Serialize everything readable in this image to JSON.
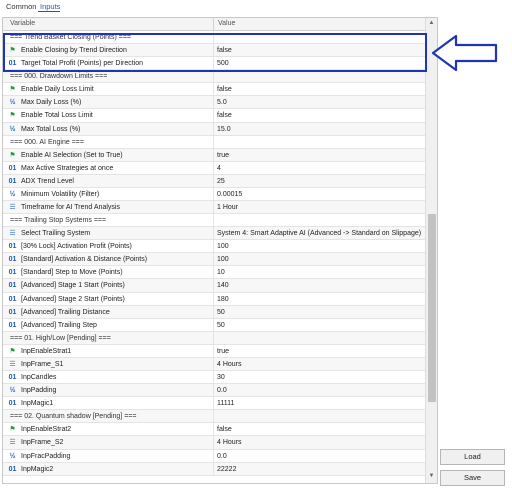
{
  "tabs": [
    {
      "label": "Common"
    },
    {
      "label": "Inputs"
    }
  ],
  "header": {
    "variable": "Variable",
    "value": "Value"
  },
  "rows": [
    {
      "type": "section",
      "label": "=== Trend Basket Closing (Points) ===",
      "value": ""
    },
    {
      "type": "bool",
      "icon": "flag-icon",
      "label": "Enable Closing by Trend Direction",
      "value": "false"
    },
    {
      "type": "int",
      "icon": "int-icon",
      "label": "Target Total Profit (Points) per Direction",
      "value": "500"
    },
    {
      "type": "section",
      "label": "=== 000. Drawdown Limits ===",
      "value": ""
    },
    {
      "type": "bool",
      "icon": "flag-icon",
      "label": "Enable Daily Loss Limit",
      "value": "false"
    },
    {
      "type": "frac",
      "icon": "fraction-icon",
      "label": "Max Daily Loss (%)",
      "value": "5.0"
    },
    {
      "type": "bool",
      "icon": "flag-icon",
      "label": "Enable Total Loss Limit",
      "value": "false"
    },
    {
      "type": "frac",
      "icon": "fraction-icon",
      "label": "Max Total Loss (%)",
      "value": "15.0"
    },
    {
      "type": "section",
      "label": "=== 000. AI Engine ===",
      "value": ""
    },
    {
      "type": "bool",
      "icon": "flag-icon",
      "label": "Enable AI Selection (Set to True)",
      "value": "true"
    },
    {
      "type": "int",
      "icon": "int-icon",
      "label": "Max Active Strategies at once",
      "value": "4"
    },
    {
      "type": "int",
      "icon": "int-icon",
      "label": "ADX Trend Level",
      "value": "25"
    },
    {
      "type": "frac",
      "icon": "fraction-icon",
      "label": "Minimum Volatility (Filter)",
      "value": "0.00015"
    },
    {
      "type": "list",
      "icon": "list-icon",
      "label": "Timeframe for AI Trend Analysis",
      "value": "1 Hour"
    },
    {
      "type": "section",
      "label": "=== Trailing Stop Systems ===",
      "value": ""
    },
    {
      "type": "list",
      "icon": "list-icon",
      "label": "Select Trailing System",
      "value": "System 4: Smart Adaptive AI (Advanced -> Standard on Slippage)"
    },
    {
      "type": "int",
      "icon": "int-icon",
      "label": "[30% Lock] Activation Profit (Points)",
      "value": "100"
    },
    {
      "type": "int",
      "icon": "int-icon",
      "label": "[Standard] Activation & Distance (Points)",
      "value": "100"
    },
    {
      "type": "int",
      "icon": "int-icon",
      "label": "[Standard] Step to Move (Points)",
      "value": "10"
    },
    {
      "type": "int",
      "icon": "int-icon",
      "label": "[Advanced] Stage 1 Start (Points)",
      "value": "140"
    },
    {
      "type": "int",
      "icon": "int-icon",
      "label": "[Advanced] Stage 2 Start (Points)",
      "value": "180"
    },
    {
      "type": "int",
      "icon": "int-icon",
      "label": "[Advanced] Trailing Distance",
      "value": "50"
    },
    {
      "type": "int",
      "icon": "int-icon",
      "label": "[Advanced] Trailing Step",
      "value": "50"
    },
    {
      "type": "section",
      "label": "=== 01. High/Low [Pending] ===",
      "value": ""
    },
    {
      "type": "bool",
      "icon": "flag-icon",
      "label": "InpEnableStrat1",
      "value": "true"
    },
    {
      "type": "list",
      "icon": "list-icon",
      "label": "InpFrame_S1",
      "value": "4 Hours"
    },
    {
      "type": "int",
      "icon": "int-icon",
      "label": "InpCandles",
      "value": "30"
    },
    {
      "type": "frac",
      "icon": "fraction-icon",
      "label": "InpPadding",
      "value": "0.0"
    },
    {
      "type": "int",
      "icon": "int-icon",
      "label": "InpMagic1",
      "value": "11111"
    },
    {
      "type": "section",
      "label": "=== 02. Quantum shadow [Pending] ===",
      "value": ""
    },
    {
      "type": "bool",
      "icon": "flag-icon",
      "label": "InpEnableStrat2",
      "value": "false"
    },
    {
      "type": "list",
      "icon": "list-icon",
      "label": "InpFrame_S2",
      "value": "4 Hours"
    },
    {
      "type": "frac",
      "icon": "fraction-icon",
      "label": "InpFracPadding",
      "value": "0.0"
    },
    {
      "type": "int",
      "icon": "int-icon",
      "label": "InpMagic2",
      "value": "22222"
    }
  ],
  "icons": {
    "int": "01",
    "frac": "½",
    "flag": "⚑",
    "list": "☰"
  },
  "buttons": {
    "load": "Load",
    "save": "Save"
  },
  "colors": {
    "accent": "#1c5db0",
    "highlight": "#1f35b8"
  }
}
